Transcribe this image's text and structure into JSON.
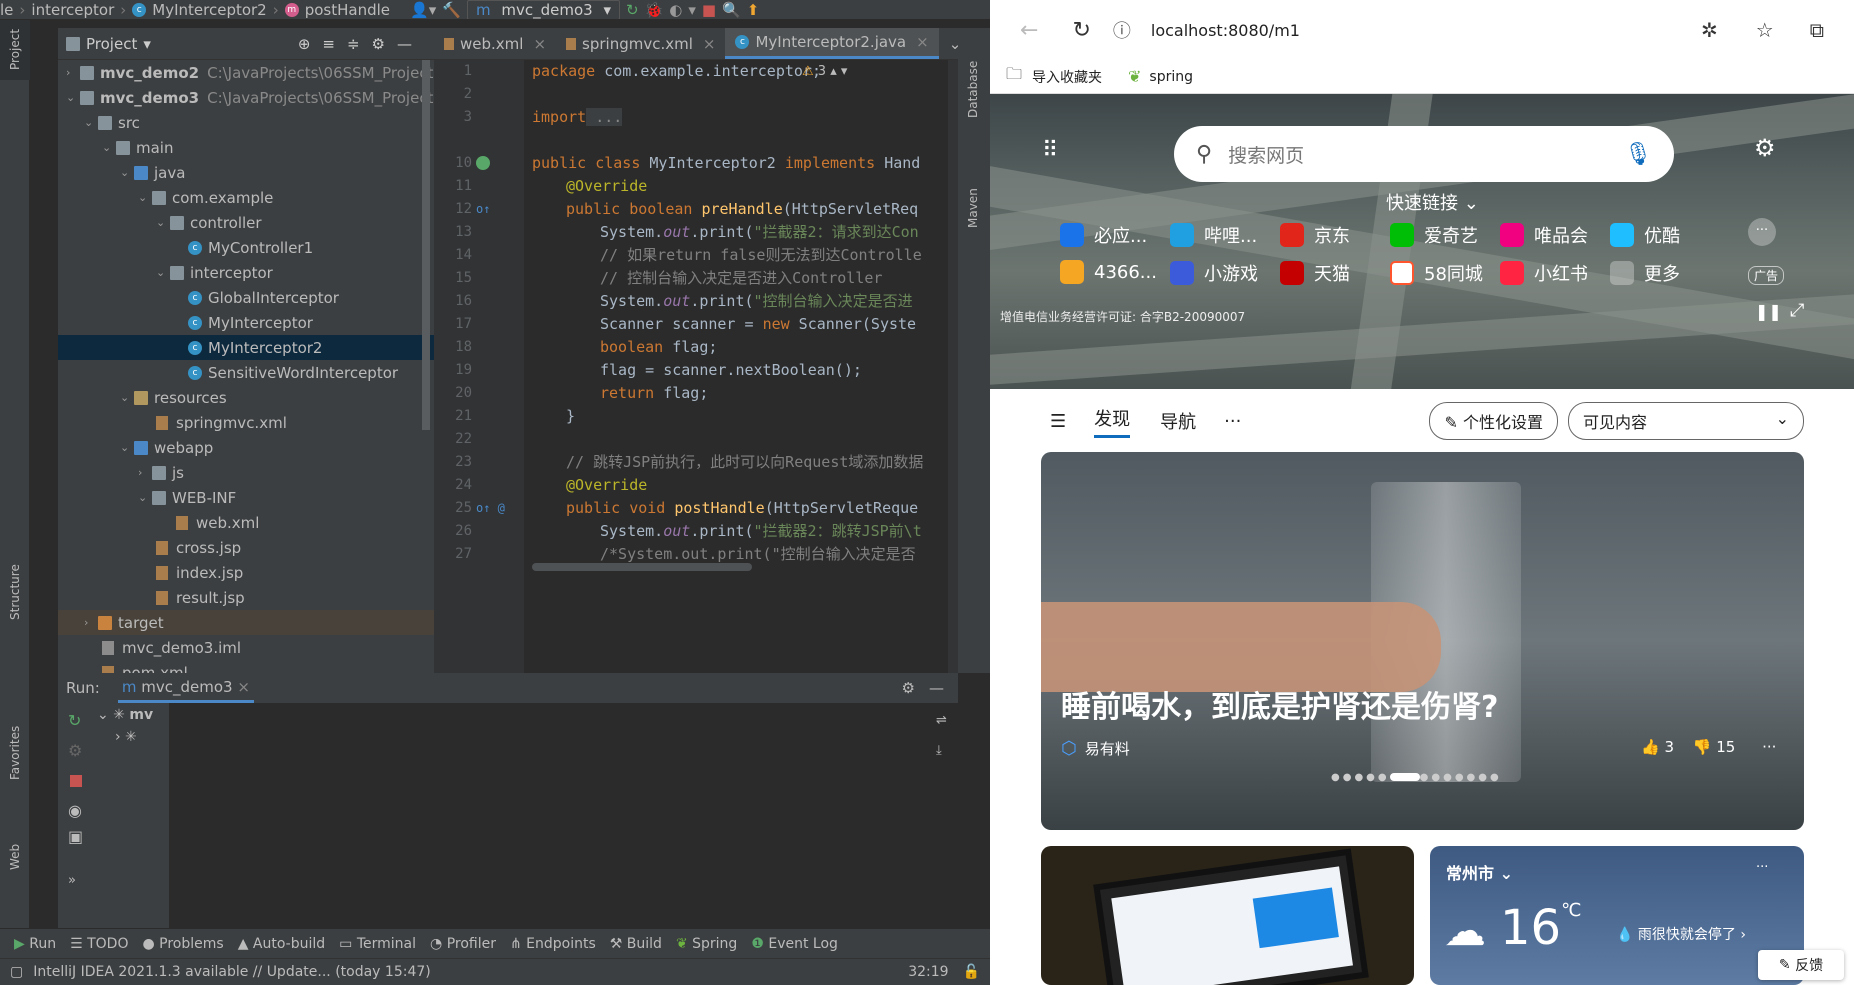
{
  "ide": {
    "breadcrumb": [
      "le",
      "interceptor",
      "MyInterceptor2",
      "postHandle"
    ],
    "run_config": "mvc_demo3",
    "project_label": "Project",
    "tree": [
      {
        "label": "mvc_demo2",
        "path": "C:\\JavaProjects\\06SSM_Project"
      },
      {
        "label": "mvc_demo3",
        "path": "C:\\JavaProjects\\06SSM_Project"
      },
      {
        "label": "src"
      },
      {
        "label": "main"
      },
      {
        "label": "java"
      },
      {
        "label": "com.example"
      },
      {
        "label": "controller"
      },
      {
        "label": "MyController1"
      },
      {
        "label": "interceptor"
      },
      {
        "label": "GlobalInterceptor"
      },
      {
        "label": "MyInterceptor"
      },
      {
        "label": "MyInterceptor2"
      },
      {
        "label": "SensitiveWordInterceptor"
      },
      {
        "label": "resources"
      },
      {
        "label": "springmvc.xml"
      },
      {
        "label": "webapp"
      },
      {
        "label": "js"
      },
      {
        "label": "WEB-INF"
      },
      {
        "label": "web.xml"
      },
      {
        "label": "cross.jsp"
      },
      {
        "label": "index.jsp"
      },
      {
        "label": "result.jsp"
      },
      {
        "label": "target"
      },
      {
        "label": "mvc_demo3.iml"
      },
      {
        "label": "pom.xml"
      }
    ],
    "tabs": [
      "web.xml",
      "springmvc.xml",
      "MyInterceptor2.java"
    ],
    "warning_count": "3",
    "line_numbers": [
      "1",
      "2",
      "3",
      "10",
      "11",
      "12",
      "13",
      "14",
      "15",
      "16",
      "17",
      "18",
      "19",
      "20",
      "21",
      "22",
      "23",
      "24",
      "25",
      "26",
      "27"
    ],
    "code": {
      "l1_kw": "package",
      "l1_rest": " com.example.interceptor;",
      "l3_kw": "import",
      "l3_rest": " ...",
      "l10_kw": "public class",
      "l10_name": " MyInterceptor2 ",
      "l10_kw2": "implements",
      "l10_rest": " Hand",
      "l11": "@Override",
      "l12_kw": "public boolean",
      "l12_fn": " preHandle",
      "l12_rest": "(HttpServletReq",
      "l13_a": "System.",
      "l13_b": "out",
      "l13_c": ".print(",
      "l13_str": "\"拦截器2：请求到达Con",
      "l14": "// 如果return false则无法到达Controlle",
      "l15": "// 控制台输入决定是否进入Controller",
      "l16_a": "System.",
      "l16_b": "out",
      "l16_c": ".print(",
      "l16_str": "\"控制台输入决定是否进",
      "l17_a": "Scanner scanner = ",
      "l17_kw": "new",
      "l17_b": " Scanner(Syste",
      "l18_kw": "boolean",
      "l18_rest": " flag;",
      "l19": "flag = scanner.nextBoolean();",
      "l20_kw": "return",
      "l20_rest": " flag;",
      "l21": "}",
      "l23": "// 跳转JSP前执行，此时可以向Request域添加数据",
      "l24": "@Override",
      "l25_kw": "public void",
      "l25_fn": " postHandle",
      "l25_rest": "(HttpServletReque",
      "l26_a": "System.",
      "l26_b": "out",
      "l26_c": ".print(",
      "l26_str": "\"拦截器2：跳转JSP前\\t",
      "l27": "/*System.out.print(\"控制台输入决定是否"
    },
    "run_label": "Run:",
    "run_tab": "mvc_demo3",
    "run_tree_item": "mv",
    "bottom_tools": [
      "Run",
      "TODO",
      "Problems",
      "Auto-build",
      "Terminal",
      "Profiler",
      "Endpoints",
      "Build",
      "Spring",
      "Event Log"
    ],
    "status_text": "IntelliJ IDEA 2021.1.3 available // Update... (today 15:47)",
    "cursor_pos": "32:19",
    "right_tools": [
      "Database",
      "Maven"
    ],
    "left_tools": [
      "Project",
      "Structure",
      "Favorites",
      "Web"
    ]
  },
  "browser": {
    "url": "localhost:8080/m1",
    "bookmarks": [
      "导入收藏夹",
      "spring"
    ],
    "search_placeholder": "搜索网页",
    "quick_links_label": "快速链接",
    "quick_links_row1": [
      "必应...",
      "哔哩...",
      "京东",
      "爱奇艺",
      "唯品会",
      "优酷"
    ],
    "quick_links_row2": [
      "4366...",
      "小游戏",
      "天猫",
      "58同城",
      "小红书",
      "更多"
    ],
    "ad_label": "广告",
    "license": "增值电信业务经营许可证: 合字B2-20090007",
    "feed_tabs": [
      "发现",
      "导航",
      "···"
    ],
    "personalize": "个性化设置",
    "visible_content": "可见内容",
    "headline": "睡前喝水，到底是护肾还是伤肾?",
    "source": "易有料",
    "likes": "3",
    "dislikes": "15",
    "weather_city": "常州市",
    "weather_temp": "16",
    "weather_unit": "℃",
    "weather_note": "雨很快就会停了",
    "feedback": "反馈",
    "accent": "#0f6cbd"
  }
}
